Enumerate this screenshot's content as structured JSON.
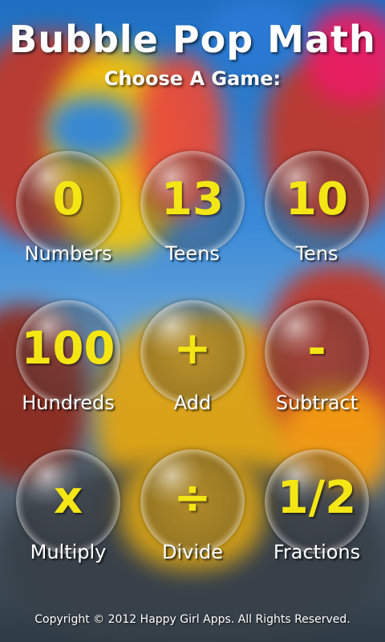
{
  "app": {
    "title": "Bubble Pop Math",
    "subtitle": "Choose A Game:"
  },
  "games": [
    {
      "symbol": "0",
      "label": "Numbers"
    },
    {
      "symbol": "13",
      "label": "Teens"
    },
    {
      "symbol": "10",
      "label": "Tens"
    },
    {
      "symbol": "100",
      "label": "Hundreds"
    },
    {
      "symbol": "+",
      "label": "Add"
    },
    {
      "symbol": "-",
      "label": "Subtract"
    },
    {
      "symbol": "x",
      "label": "Multiply"
    },
    {
      "symbol": "÷",
      "label": "Divide"
    },
    {
      "symbol": "1/2",
      "label": "Fractions"
    }
  ],
  "footer": {
    "copyright": "Copyright © 2012 Happy Girl Apps. All Rights Reserved."
  },
  "colors": {
    "symbol": "#f4e614",
    "label": "#ffffff"
  }
}
